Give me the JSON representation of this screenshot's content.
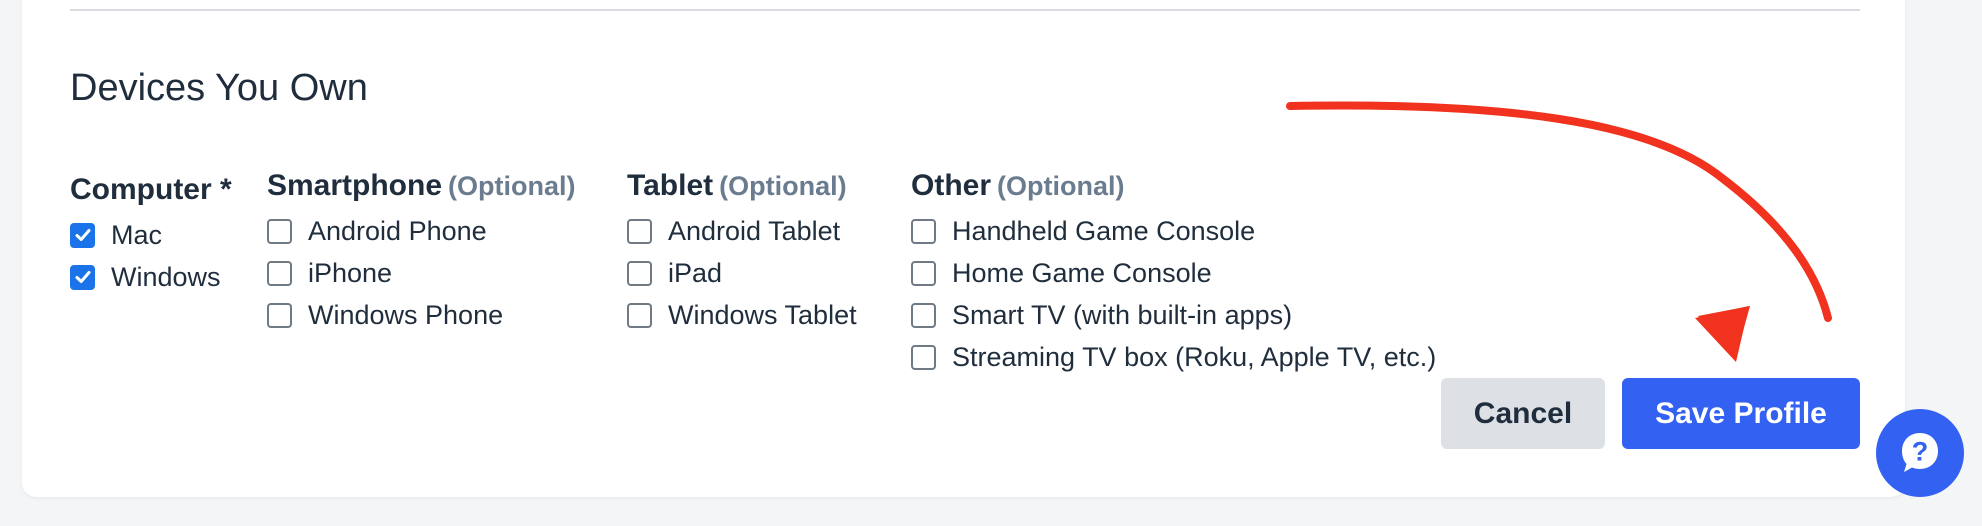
{
  "section": {
    "title": "Devices You Own"
  },
  "groups": [
    {
      "title": "Computer",
      "suffix": "*",
      "optional": "",
      "options": [
        {
          "label": "Mac",
          "checked": true
        },
        {
          "label": "Windows",
          "checked": true
        }
      ]
    },
    {
      "title": "Smartphone",
      "suffix": "",
      "optional": "(Optional)",
      "options": [
        {
          "label": "Android Phone",
          "checked": false
        },
        {
          "label": "iPhone",
          "checked": false
        },
        {
          "label": "Windows Phone",
          "checked": false
        }
      ]
    },
    {
      "title": "Tablet",
      "suffix": "",
      "optional": "(Optional)",
      "options": [
        {
          "label": "Android Tablet",
          "checked": false
        },
        {
          "label": "iPad",
          "checked": false
        },
        {
          "label": "Windows Tablet",
          "checked": false
        }
      ]
    },
    {
      "title": "Other",
      "suffix": "",
      "optional": "(Optional)",
      "options": [
        {
          "label": "Handheld Game Console",
          "checked": false
        },
        {
          "label": "Home Game Console",
          "checked": false
        },
        {
          "label": "Smart TV (with built-in apps)",
          "checked": false
        },
        {
          "label": "Streaming TV box (Roku, Apple TV, etc.)",
          "checked": false
        }
      ]
    }
  ],
  "actions": {
    "cancel_label": "Cancel",
    "save_label": "Save Profile"
  },
  "help": {
    "icon": "question-icon"
  },
  "annotation": {
    "icon": "red-arrow-icon",
    "color": "#f0321e"
  },
  "colors": {
    "accent": "#3361f2",
    "checkbox_checked": "#1a73e8",
    "text": "#1f2d3d",
    "muted": "#6b7c8f"
  }
}
